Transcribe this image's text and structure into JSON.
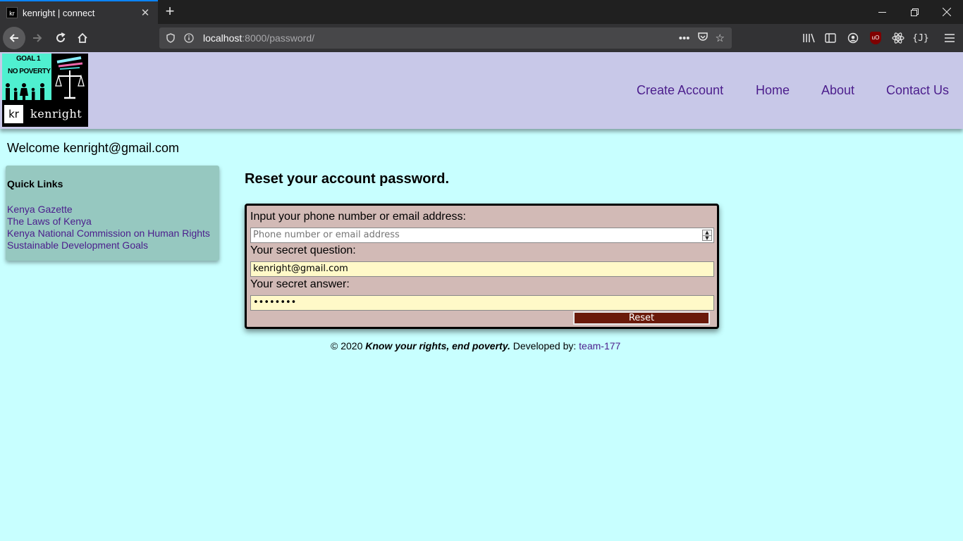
{
  "browser": {
    "tab_title": "kenright | connect",
    "tab_favicon": "kr",
    "url_host": "localhost",
    "url_path": ":8000/password/"
  },
  "site": {
    "logo": {
      "goal": "GOAL 1",
      "no_poverty": "NO POVERTY",
      "kr": "kr",
      "name": "kenright"
    },
    "nav": [
      "Create Account",
      "Home",
      "About",
      "Contact Us"
    ]
  },
  "welcome": "Welcome kenright@gmail.com",
  "quick_links": {
    "title": "Quick Links",
    "links": [
      "Kenya Gazette",
      "The Laws of Kenya",
      "Kenya National Commission on Human Rights",
      "Sustainable Development Goals"
    ]
  },
  "reset": {
    "title": "Reset your account password.",
    "phone_label": "Input your phone number or email address:",
    "phone_placeholder": "Phone number or email address",
    "question_label": "Your secret question:",
    "question_value": "kenright@gmail.com",
    "answer_label": "Your secret answer:",
    "answer_value": "••••••••",
    "button": "Reset"
  },
  "footer": {
    "copyright": "© 2020",
    "tagline": "Know your rights, end poverty.",
    "developed": "Developed by:",
    "team": "team-177"
  },
  "colors": {
    "page_bg": "#c8ffff",
    "header_bg": "#c8c8e8",
    "link": "#4b1d8c",
    "form_bg": "#d2bab6",
    "quicklinks_bg": "#96c8c0",
    "button_bg": "#6a1a0a"
  }
}
